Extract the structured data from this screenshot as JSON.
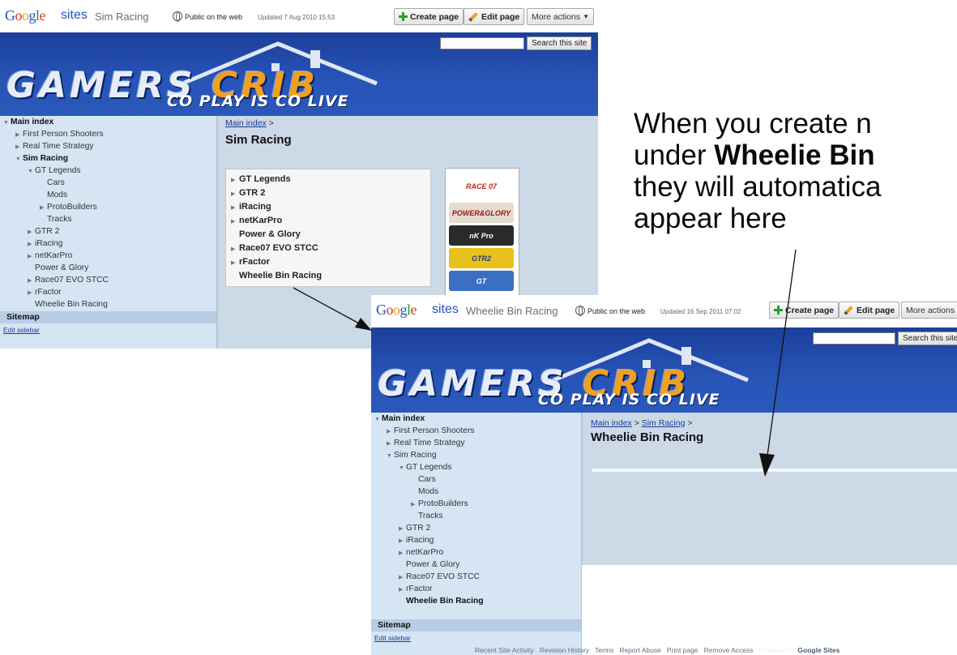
{
  "logo_letters": [
    "G",
    "o",
    "o",
    "g",
    "l",
    "e"
  ],
  "colors": {
    "banner": "#2855b7",
    "sidebar": "#d5e5f3",
    "content": "#ccd9e6",
    "link": "#1a3b9a"
  },
  "window1": {
    "sites_word": "sites",
    "site_name": "Sim Racing",
    "public_label": "Public on the web",
    "updated": "Updated 7 Aug 2010 15:53",
    "create_page": "Create page",
    "edit_page": "Edit page",
    "more_actions": "More actions",
    "search_button": "Search this site",
    "logo_part1": "GAMERS",
    "logo_part2": "CRIB",
    "logo_tagline": "CO PLAY IS CO LIVE",
    "breadcrumb_link": "Main index",
    "breadcrumb_sep": " >",
    "page_title": "Sim Racing",
    "sidebar": [
      {
        "label": "Main index",
        "indent": 0,
        "arrow": "down",
        "bold": true
      },
      {
        "label": "First Person Shooters",
        "indent": 1,
        "arrow": "right",
        "bold": false
      },
      {
        "label": "Real Time Strategy",
        "indent": 1,
        "arrow": "right",
        "bold": false
      },
      {
        "label": "Sim Racing",
        "indent": 1,
        "arrow": "down",
        "bold": true
      },
      {
        "label": "GT Legends",
        "indent": 2,
        "arrow": "down",
        "bold": false
      },
      {
        "label": "Cars",
        "indent": 3,
        "arrow": "",
        "bold": false
      },
      {
        "label": "Mods",
        "indent": 3,
        "arrow": "",
        "bold": false
      },
      {
        "label": "ProtoBuilders",
        "indent": 3,
        "arrow": "right",
        "bold": false
      },
      {
        "label": "Tracks",
        "indent": 3,
        "arrow": "",
        "bold": false
      },
      {
        "label": "GTR 2",
        "indent": 2,
        "arrow": "right",
        "bold": false
      },
      {
        "label": "iRacing",
        "indent": 2,
        "arrow": "right",
        "bold": false
      },
      {
        "label": "netKarPro",
        "indent": 2,
        "arrow": "right",
        "bold": false
      },
      {
        "label": "Power & Glory",
        "indent": 2,
        "arrow": "",
        "bold": false
      },
      {
        "label": "Race07 EVO STCC",
        "indent": 2,
        "arrow": "right",
        "bold": false
      },
      {
        "label": "rFactor",
        "indent": 2,
        "arrow": "right",
        "bold": false
      },
      {
        "label": "Wheelie Bin Racing",
        "indent": 2,
        "arrow": "",
        "bold": false
      }
    ],
    "sitemap": "Sitemap",
    "edit_sidebar": "Edit sidebar",
    "subpages": [
      {
        "label": "GT Legends",
        "arrow": true
      },
      {
        "label": "GTR 2",
        "arrow": true
      },
      {
        "label": "iRacing",
        "arrow": true
      },
      {
        "label": "netKarPro",
        "arrow": true
      },
      {
        "label": "Power & Glory",
        "arrow": false
      },
      {
        "label": "Race07 EVO STCC",
        "arrow": true
      },
      {
        "label": "rFactor",
        "arrow": true
      },
      {
        "label": "Wheelie Bin Racing",
        "arrow": false
      }
    ],
    "thumbnails": [
      {
        "text": "RACE 07",
        "bg": "#ffffff",
        "fg": "#c0221c"
      },
      {
        "text": "POWER&GLORY",
        "bg": "#e4dcd0",
        "fg": "#a01818"
      },
      {
        "text": "nK Pro",
        "bg": "#2a2a2a",
        "fg": "#ffffff"
      },
      {
        "text": "GTR2",
        "bg": "#e8c21a",
        "fg": "#1c3a8a"
      },
      {
        "text": "GT",
        "bg": "#3a6fc4",
        "fg": "#ffffff"
      }
    ]
  },
  "window2": {
    "sites_word": "sites",
    "site_name": "Wheelie Bin Racing",
    "public_label": "Public on the web",
    "updated": "Updated 16 Sep 2011 07:02",
    "create_page": "Create page",
    "edit_page": "Edit page",
    "more_actions": "More actions",
    "search_button": "Search this site",
    "logo_part1": "GAMERS",
    "logo_part2": "CRIB",
    "logo_tagline": "CO PLAY IS CO LIVE",
    "breadcrumb_link1": "Main index",
    "breadcrumb_sep1": " > ",
    "breadcrumb_link2": "Sim Racing",
    "breadcrumb_sep2": " >",
    "page_title": "Wheelie Bin Racing",
    "sidebar": [
      {
        "label": "Main index",
        "indent": 0,
        "arrow": "down",
        "bold": true
      },
      {
        "label": "First Person Shooters",
        "indent": 1,
        "arrow": "right",
        "bold": false
      },
      {
        "label": "Real Time Strategy",
        "indent": 1,
        "arrow": "right",
        "bold": false
      },
      {
        "label": "Sim Racing",
        "indent": 1,
        "arrow": "down",
        "bold": false
      },
      {
        "label": "GT Legends",
        "indent": 2,
        "arrow": "down",
        "bold": false
      },
      {
        "label": "Cars",
        "indent": 3,
        "arrow": "",
        "bold": false
      },
      {
        "label": "Mods",
        "indent": 3,
        "arrow": "",
        "bold": false
      },
      {
        "label": "ProtoBuilders",
        "indent": 3,
        "arrow": "right",
        "bold": false
      },
      {
        "label": "Tracks",
        "indent": 3,
        "arrow": "",
        "bold": false
      },
      {
        "label": "GTR 2",
        "indent": 2,
        "arrow": "right",
        "bold": false
      },
      {
        "label": "iRacing",
        "indent": 2,
        "arrow": "right",
        "bold": false
      },
      {
        "label": "netKarPro",
        "indent": 2,
        "arrow": "right",
        "bold": false
      },
      {
        "label": "Power & Glory",
        "indent": 2,
        "arrow": "",
        "bold": false
      },
      {
        "label": "Race07 EVO STCC",
        "indent": 2,
        "arrow": "right",
        "bold": false
      },
      {
        "label": "rFactor",
        "indent": 2,
        "arrow": "right",
        "bold": false
      },
      {
        "label": "Wheelie Bin Racing",
        "indent": 2,
        "arrow": "",
        "bold": true
      }
    ],
    "sitemap": "Sitemap",
    "edit_sidebar": "Edit sidebar",
    "footer": [
      "Recent Site Activity",
      "Revision History",
      "Terms",
      "Report Abuse",
      "Print page",
      "Remove Access"
    ],
    "footer_powered": "Powered by",
    "footer_google_sites": "Google Sites"
  },
  "annotation": {
    "line1": "When you create n",
    "line2_pre": "under ",
    "line2_bold": "Wheelie Bin",
    "line3": "they will automatica",
    "line4": "appear here"
  }
}
